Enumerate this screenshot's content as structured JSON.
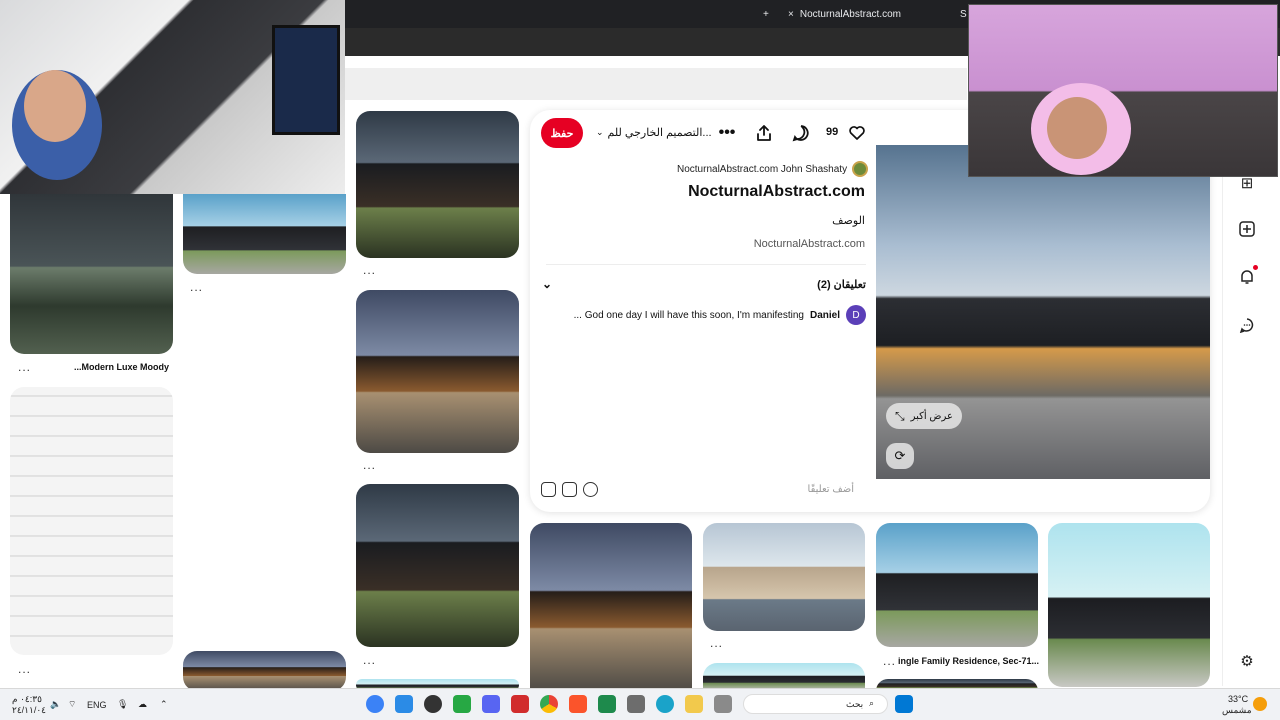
{
  "browser": {
    "tabs": [
      {
        "label": "NocturnalAbstract.com",
        "active": true
      },
      {
        "label": "S",
        "active": false
      }
    ],
    "new_tab_glyph": "+",
    "close_glyph": "×"
  },
  "pin": {
    "save_label": "حفظ",
    "board_name": "التصميم الخارجي للم...",
    "reaction_count": "99",
    "author": "NocturnalAbstract.com John Shashaty",
    "title": "NocturnalAbstract.com",
    "description_label": "الوصف",
    "link": "NocturnalAbstract.com",
    "comments_header": "تعليقان (2)",
    "comment": {
      "avatar_letter": "D",
      "user": "Daniel",
      "text": "... God one day I will have this soon, I'm manifesting"
    },
    "add_comment_placeholder": "أضف تعليقًا",
    "enlarge_label": "عرض أكبر"
  },
  "feed": {
    "captions": {
      "modern_luxe": "...Modern Luxe Moody",
      "single_family": "ingle Family Residence, Sec-71..."
    },
    "more_glyph": "..."
  },
  "taskbar": {
    "time": "٠٤:٣٥ م",
    "date": "٢٤/١١/٠٤",
    "language": "ENG",
    "search_placeholder": "بحث",
    "weather_temp": "33°C",
    "weather_desc": "مشمس"
  },
  "colors": {
    "accent": "#e60023",
    "chrome_dark": "#202124",
    "avatar_purple": "#5b3fb8"
  },
  "icons": [
    "heart-icon",
    "comment-icon",
    "share-icon",
    "more-icon",
    "chevron-down-icon",
    "expand-icon",
    "lens-icon",
    "plus-icon",
    "bell-icon",
    "chat-icon",
    "settings-icon",
    "gif-icon",
    "sticker-icon",
    "emoji-icon"
  ]
}
